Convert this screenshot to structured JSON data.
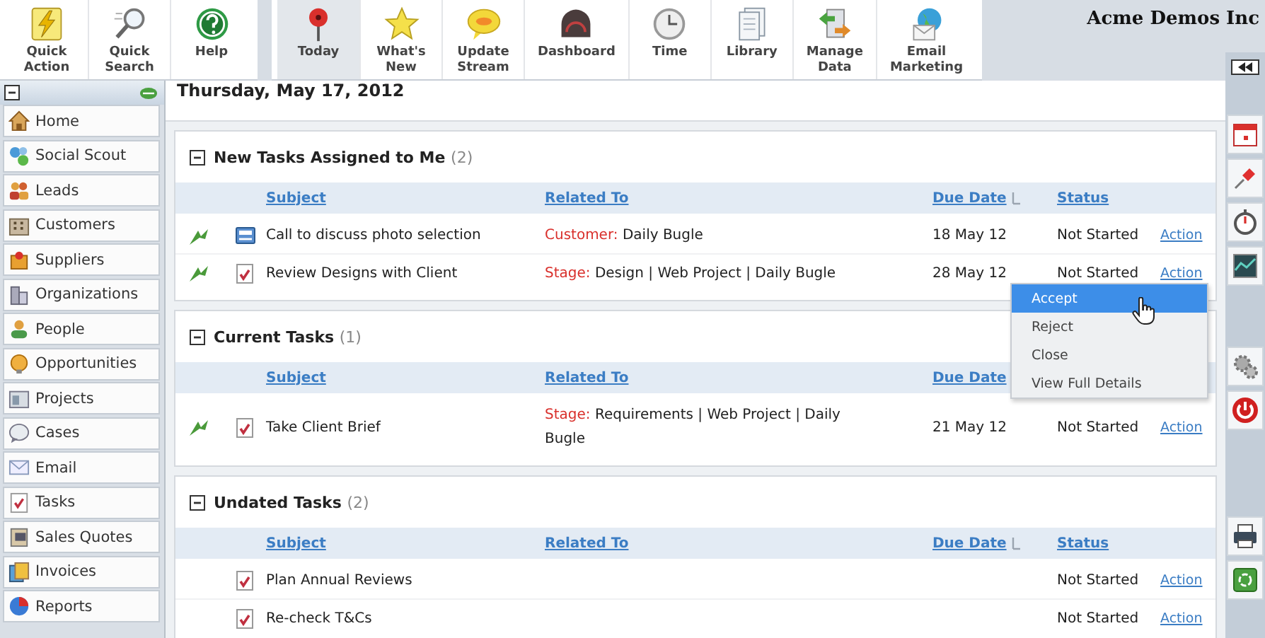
{
  "toolbar": {
    "groups": [
      [
        {
          "label": "Quick Action",
          "selected": false
        },
        {
          "label": "Quick Search",
          "selected": false
        },
        {
          "label": "Help",
          "selected": false
        }
      ],
      [
        {
          "label": "Today",
          "selected": true
        },
        {
          "label": "What's New",
          "selected": false
        },
        {
          "label": "Update Stream",
          "selected": false
        },
        {
          "label": "Dashboard",
          "selected": false
        },
        {
          "label": "Time",
          "selected": false
        },
        {
          "label": "Library",
          "selected": false
        },
        {
          "label": "Manage Data",
          "selected": false
        },
        {
          "label": "Email Marketing",
          "selected": false
        }
      ]
    ]
  },
  "company": "Acme Demos Inc",
  "sidebar": {
    "expanded": true,
    "items": [
      "Home",
      "Social Scout",
      "Leads",
      "Customers",
      "Suppliers",
      "Organizations",
      "People",
      "Opportunities",
      "Projects",
      "Cases",
      "Email",
      "Tasks",
      "Sales Quotes",
      "Invoices",
      "Reports"
    ]
  },
  "date": "Thursday, May 17, 2012",
  "sections": [
    {
      "title": "New Tasks Assigned to Me",
      "count": "(2)",
      "expanded": true,
      "columns": [
        {
          "label": "Subject",
          "sorted": false
        },
        {
          "label": "Related To",
          "sorted": false
        },
        {
          "label": "Due Date",
          "sorted": true
        },
        {
          "label": "Status",
          "sorted": false
        }
      ],
      "rows": [
        {
          "flagged": true,
          "kind": "call",
          "subject": "Call to discuss photo selection",
          "related_label": "Customer:",
          "related": "Daily Bugle",
          "due": "18 May 12",
          "status": "Not Started",
          "action": "Action"
        },
        {
          "flagged": true,
          "kind": "task",
          "subject": "Review Designs with Client",
          "related_label": "Stage:",
          "related": "Design | Web Project | Daily Bugle",
          "due": "28 May 12",
          "status": "Not Started",
          "action": "Action"
        }
      ]
    },
    {
      "title": "Current Tasks",
      "count": "(1)",
      "expanded": true,
      "columns": [
        {
          "label": "Subject",
          "sorted": false
        },
        {
          "label": "Related To",
          "sorted": false
        },
        {
          "label": "Due Date",
          "sorted": false
        }
      ],
      "rows": [
        {
          "flagged": true,
          "kind": "task",
          "subject": "Take Client Brief",
          "related_label": "Stage:",
          "related": "Requirements | Web Project | Daily Bugle",
          "due": "21 May 12",
          "status": "Not Started",
          "action": "Action"
        }
      ]
    },
    {
      "title": "Undated Tasks",
      "count": "(2)",
      "expanded": true,
      "columns": [
        {
          "label": "Subject",
          "sorted": false
        },
        {
          "label": "Related To",
          "sorted": false
        },
        {
          "label": "Due Date",
          "sorted": true
        },
        {
          "label": "Status",
          "sorted": false
        }
      ],
      "rows": [
        {
          "flagged": false,
          "kind": "task",
          "subject": "Plan Annual Reviews",
          "status": "Not Started",
          "action": "Action"
        },
        {
          "flagged": false,
          "kind": "task",
          "subject": "Re-check T&Cs",
          "status": "Not Started",
          "action": "Action"
        }
      ]
    }
  ],
  "action_menu": {
    "items": [
      {
        "label": "Accept",
        "selected": true
      },
      {
        "label": "Reject",
        "selected": false
      },
      {
        "label": "Close",
        "selected": false
      },
      {
        "label": "View Full Details",
        "selected": false
      }
    ]
  }
}
